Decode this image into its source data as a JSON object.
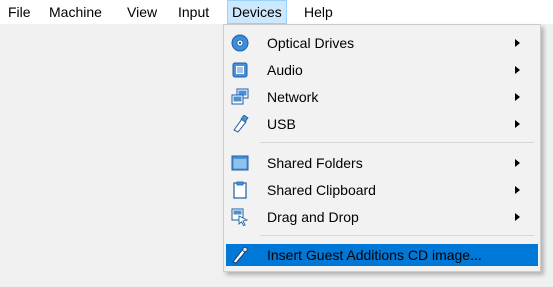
{
  "menubar": {
    "items": [
      "File",
      "Machine",
      "View",
      "Input",
      "Devices",
      "Help"
    ]
  },
  "devices_menu": {
    "items": [
      {
        "label": "Optical Drives",
        "icon": "optical-disc-icon",
        "submenu": true
      },
      {
        "label": "Audio",
        "icon": "audio-icon",
        "submenu": true
      },
      {
        "label": "Network",
        "icon": "network-icon",
        "submenu": true
      },
      {
        "label": "USB",
        "icon": "usb-icon",
        "submenu": true
      },
      {
        "label": "Shared Folders",
        "icon": "shared-folder-icon",
        "submenu": true
      },
      {
        "label": "Shared Clipboard",
        "icon": "clipboard-icon",
        "submenu": true
      },
      {
        "label": "Drag and Drop",
        "icon": "drag-drop-icon",
        "submenu": true
      },
      {
        "label": "Insert Guest Additions CD image...",
        "icon": "guest-additions-icon",
        "submenu": false,
        "highlighted": true
      }
    ]
  },
  "colors": {
    "highlight": "#0078d7",
    "menu_background": "#f2f2f2",
    "icon_blue": "#2f78c4"
  }
}
